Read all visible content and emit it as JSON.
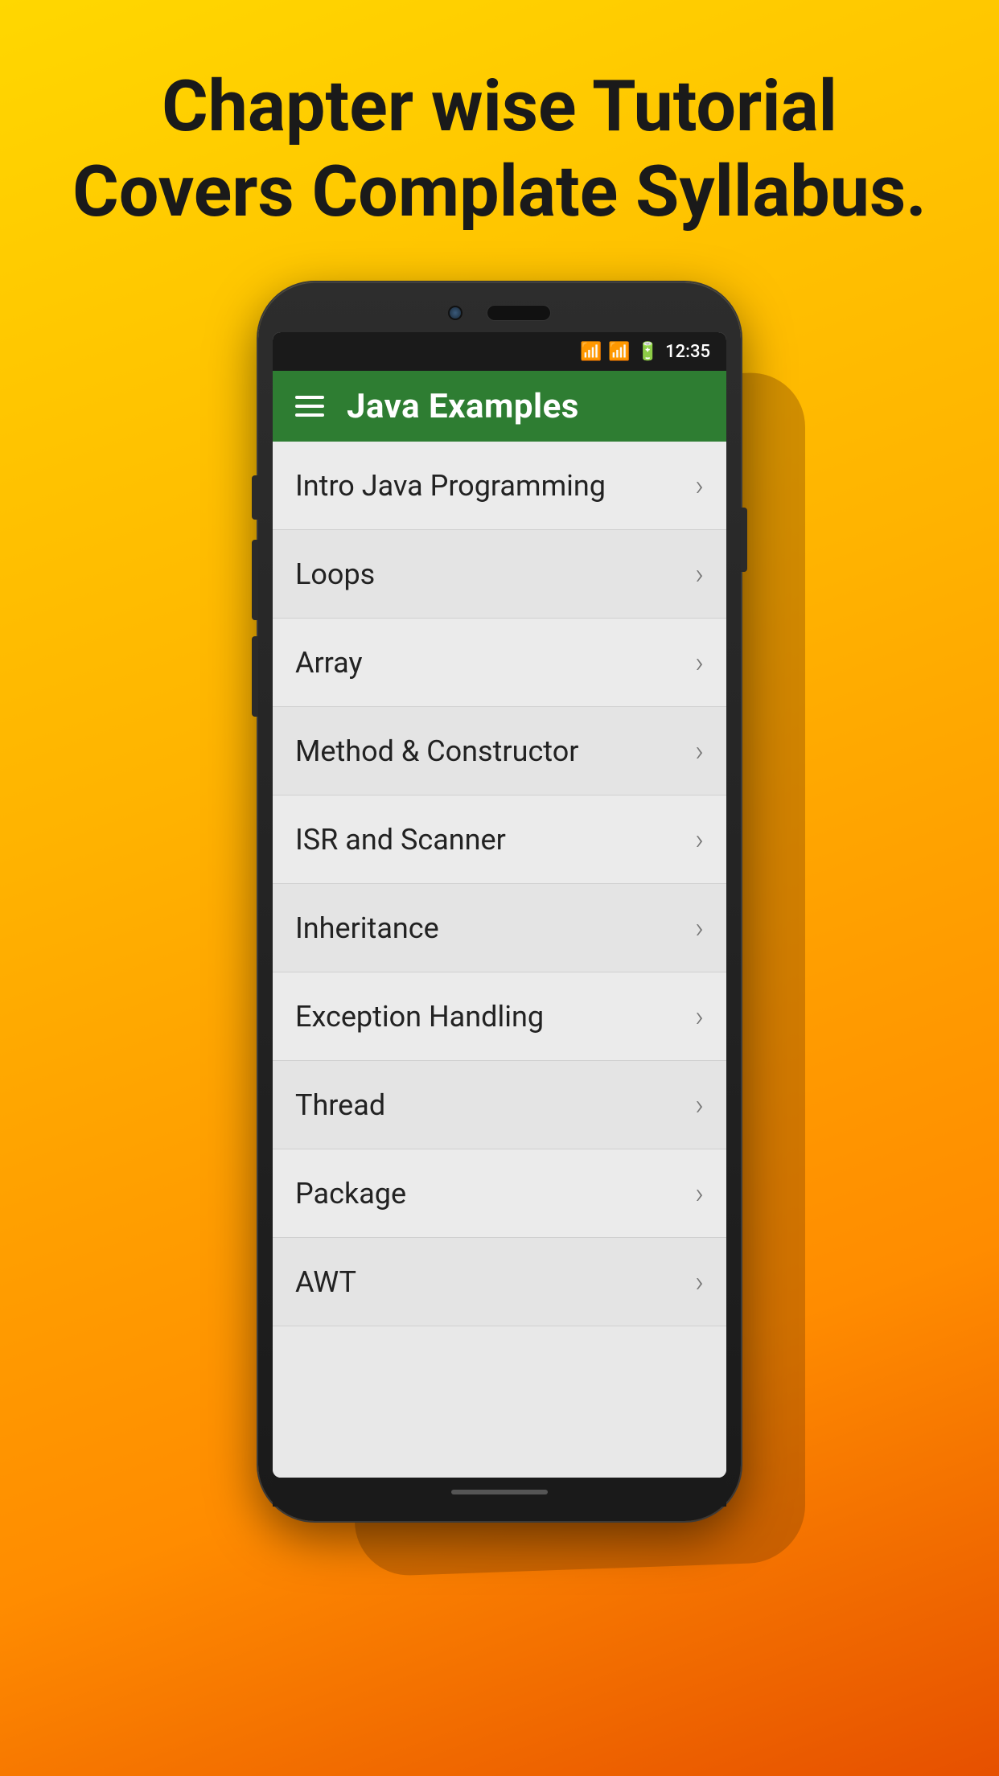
{
  "header": {
    "title": "Chapter wise Tutorial Covers Complate Syllabus."
  },
  "phone": {
    "status_bar": {
      "time": "12:35"
    },
    "toolbar": {
      "title": "Java Examples",
      "menu_icon": "hamburger-menu"
    },
    "menu_items": [
      {
        "label": "Intro Java Programming",
        "id": "intro-java"
      },
      {
        "label": "Loops",
        "id": "loops"
      },
      {
        "label": "Array",
        "id": "array"
      },
      {
        "label": "Method & Constructor",
        "id": "method-constructor"
      },
      {
        "label": "ISR and Scanner",
        "id": "isr-scanner"
      },
      {
        "label": "Inheritance",
        "id": "inheritance"
      },
      {
        "label": "Exception Handling",
        "id": "exception-handling"
      },
      {
        "label": "Thread",
        "id": "thread"
      },
      {
        "label": "Package",
        "id": "package"
      },
      {
        "label": "AWT",
        "id": "awt"
      }
    ],
    "chevron": "›"
  }
}
